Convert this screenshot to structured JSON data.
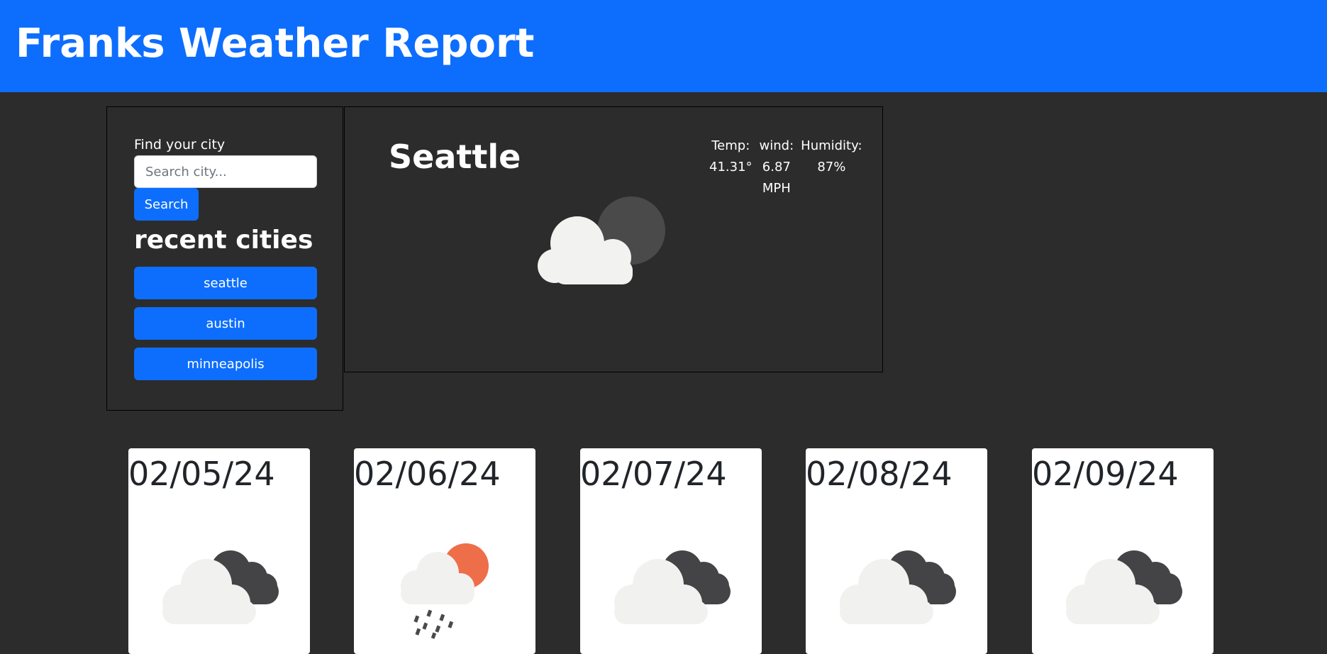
{
  "header": {
    "title": "Franks Weather Report"
  },
  "sidebar": {
    "find_label": "Find your city",
    "search_placeholder": "Search city...",
    "search_button": "Search",
    "recent_title": "recent cities",
    "recent_cities": [
      "seattle",
      "austin",
      "minneapolis"
    ]
  },
  "current": {
    "city": "Seattle",
    "icon": "cloudy-night-icon",
    "stats": [
      {
        "label": "Temp:",
        "value": "41.31°"
      },
      {
        "label": "wind:",
        "value": "6.87 MPH"
      },
      {
        "label": "Humidity:",
        "value": "87%"
      }
    ]
  },
  "forecast": [
    {
      "date": "02/05/24",
      "icon": "cloudy-icon"
    },
    {
      "date": "02/06/24",
      "icon": "rain-sun-icon"
    },
    {
      "date": "02/07/24",
      "icon": "cloudy-icon"
    },
    {
      "date": "02/08/24",
      "icon": "cloudy-icon"
    },
    {
      "date": "02/09/24",
      "icon": "cloudy-icon"
    }
  ],
  "colors": {
    "primary": "#0d6efd",
    "background": "#2c2c2c",
    "card": "#ffffff",
    "sun": "#ee6e4a"
  }
}
